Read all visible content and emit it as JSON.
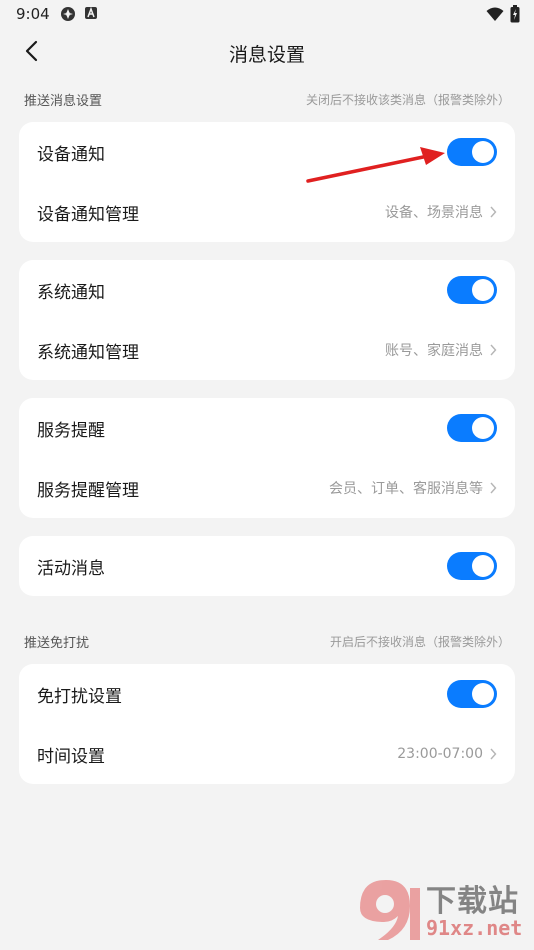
{
  "status_bar": {
    "time": "9:04",
    "icons": [
      "location-icon",
      "app-notification-icon",
      "wifi-icon",
      "battery-icon"
    ]
  },
  "header": {
    "title": "消息设置",
    "back_icon": "back-chevron-icon"
  },
  "sections": [
    {
      "title": "推送消息设置",
      "note": "关闭后不接收该类消息（报警类除外）"
    },
    {
      "title": "推送免打扰",
      "note": "开启后不接收消息（报警类除外）"
    }
  ],
  "cards": {
    "device": {
      "toggle_label": "设备通知",
      "toggle_on": true,
      "manage_label": "设备通知管理",
      "manage_value": "设备、场景消息"
    },
    "system": {
      "toggle_label": "系统通知",
      "toggle_on": true,
      "manage_label": "系统通知管理",
      "manage_value": "账号、家庭消息"
    },
    "service": {
      "toggle_label": "服务提醒",
      "toggle_on": true,
      "manage_label": "服务提醒管理",
      "manage_value": "会员、订单、客服消息等"
    },
    "activity": {
      "toggle_label": "活动消息",
      "toggle_on": true
    },
    "dnd": {
      "toggle_label": "免打扰设置",
      "toggle_on": true,
      "time_label": "时间设置",
      "time_value": "23:00-07:00"
    }
  },
  "colors": {
    "accent": "#0a7cff",
    "background": "#f3f3f3",
    "card": "#ffffff",
    "annotation_arrow": "#e02020"
  },
  "watermark": {
    "brand": "下载站",
    "url": "91xz.net"
  }
}
